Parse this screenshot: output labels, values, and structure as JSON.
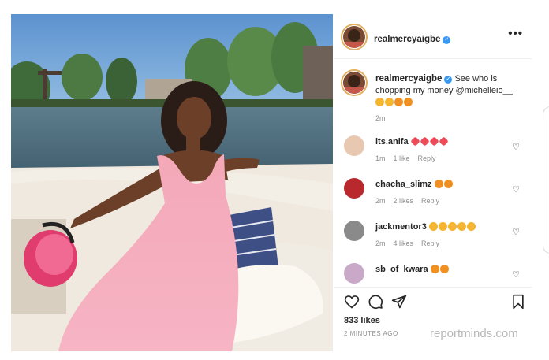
{
  "post": {
    "username": "realmercyaigbe",
    "verified_glyph": "✓",
    "more_icon": "•••",
    "caption": "See who is chopping my money @michelleio__",
    "caption_time": "2m",
    "likes": "833 likes",
    "time_ago": "2 MINUTES AGO"
  },
  "comments": [
    {
      "user": "its.anifa",
      "text": "",
      "emojis": [
        "heart",
        "heart",
        "heart",
        "heart"
      ],
      "time": "1m",
      "likes": "1 like",
      "reply": "Reply",
      "avatar_color": "#e8c8b0"
    },
    {
      "user": "chacha_slimz",
      "text": "",
      "emojis": [
        "fire",
        "fire"
      ],
      "time": "2m",
      "likes": "2 likes",
      "reply": "Reply",
      "avatar_color": "#b8282c"
    },
    {
      "user": "jackmentor3",
      "text": "",
      "emojis": [
        "heart-eyes",
        "heart-eyes",
        "heart-eyes",
        "heart-eyes",
        "heart-eyes"
      ],
      "time": "2m",
      "likes": "4 likes",
      "reply": "Reply",
      "avatar_color": "#8a8a8a"
    },
    {
      "user": "sb_of_kwara",
      "text": "",
      "emojis": [
        "fire",
        "fire"
      ],
      "time": "",
      "likes": "",
      "reply": "",
      "avatar_color": "#c9a8c8"
    }
  ],
  "watermark": "reportminds.com",
  "colors": {
    "verified": "#3897f0",
    "heart": "#ed4956",
    "fire": "#f09020",
    "heart_eyes": "#f5b530"
  }
}
